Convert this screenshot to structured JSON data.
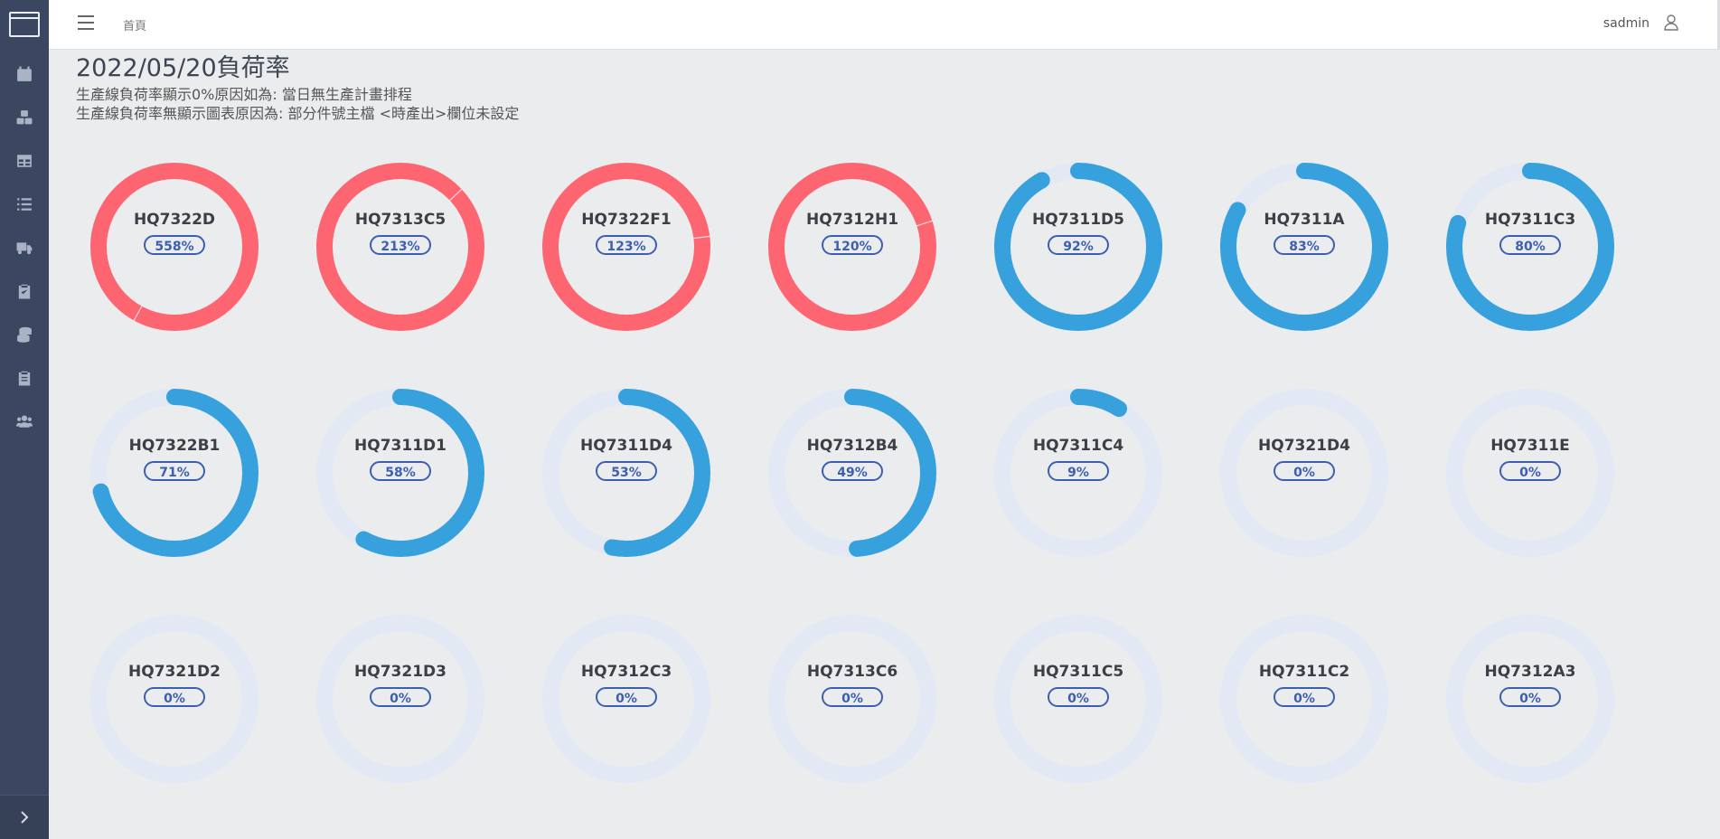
{
  "colors": {
    "over_capacity": "#fd6570",
    "under_capacity": "#36a1dc",
    "track": "#e2e8f4",
    "sidebar_bg": "#3b4660"
  },
  "sidebar": {
    "items": [
      {
        "icon": "calendar-icon"
      },
      {
        "icon": "cubes-icon"
      },
      {
        "icon": "table-icon"
      },
      {
        "icon": "list-icon"
      },
      {
        "icon": "truck-icon"
      },
      {
        "icon": "clipboard-check-icon"
      },
      {
        "icon": "coins-icon"
      },
      {
        "icon": "clipboard-icon"
      },
      {
        "icon": "users-icon"
      }
    ],
    "expand_icon": "chevron-right-icon"
  },
  "header": {
    "breadcrumb": "首頁",
    "user": "sadmin"
  },
  "main": {
    "title": "2022/05/20負荷率",
    "notes": [
      "生產線負荷率顯示0%原因如為:  當日無生產計畫排程",
      "生產線負荷率無顯示圖表原因為: 部分件號主檔 <時產出>欄位未設定"
    ]
  },
  "gauges": [
    {
      "name": "HQ7322D",
      "label": "558%",
      "value": 558
    },
    {
      "name": "HQ7313C5",
      "label": "213%",
      "value": 213
    },
    {
      "name": "HQ7322F1",
      "label": "123%",
      "value": 123
    },
    {
      "name": "HQ7312H1",
      "label": "120%",
      "value": 120
    },
    {
      "name": "HQ7311D5",
      "label": "92%",
      "value": 92
    },
    {
      "name": "HQ7311A",
      "label": "83%",
      "value": 83
    },
    {
      "name": "HQ7311C3",
      "label": "80%",
      "value": 80
    },
    {
      "name": "HQ7322B1",
      "label": "71%",
      "value": 71
    },
    {
      "name": "HQ7311D1",
      "label": "58%",
      "value": 58
    },
    {
      "name": "HQ7311D4",
      "label": "53%",
      "value": 53
    },
    {
      "name": "HQ7312B4",
      "label": "49%",
      "value": 49
    },
    {
      "name": "HQ7311C4",
      "label": "9%",
      "value": 9
    },
    {
      "name": "HQ7321D4",
      "label": "0%",
      "value": 0
    },
    {
      "name": "HQ7311E",
      "label": "0%",
      "value": 0
    },
    {
      "name": "HQ7321D2",
      "label": "0%",
      "value": 0
    },
    {
      "name": "HQ7321D3",
      "label": "0%",
      "value": 0
    },
    {
      "name": "HQ7312C3",
      "label": "0%",
      "value": 0
    },
    {
      "name": "HQ7313C6",
      "label": "0%",
      "value": 0
    },
    {
      "name": "HQ7311C5",
      "label": "0%",
      "value": 0
    },
    {
      "name": "HQ7311C2",
      "label": "0%",
      "value": 0
    },
    {
      "name": "HQ7312A3",
      "label": "0%",
      "value": 0
    }
  ]
}
